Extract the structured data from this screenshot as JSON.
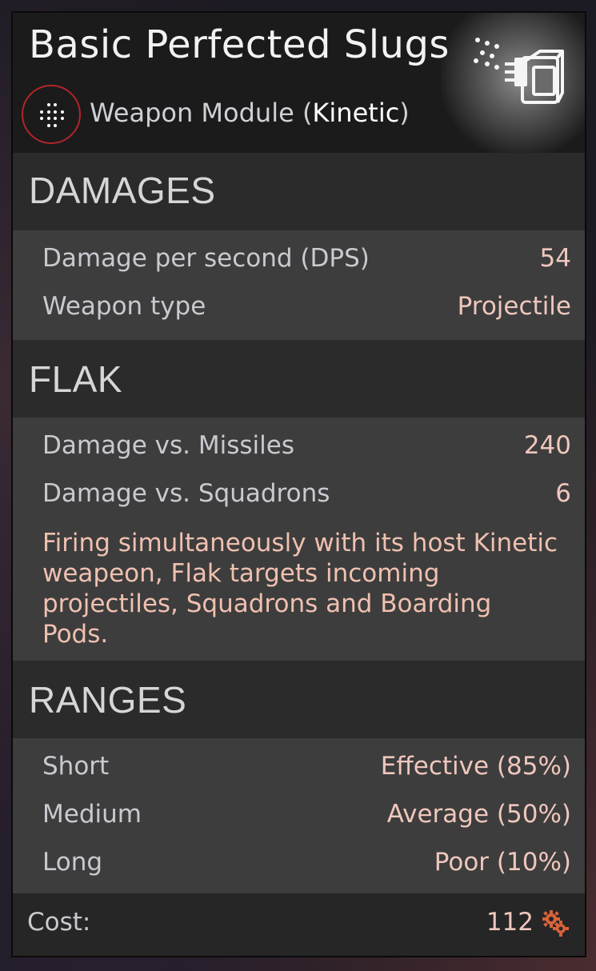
{
  "header": {
    "title": "Basic Perfected Slugs",
    "subtitle_prefix": "Weapon Module (",
    "subtitle_type": "Kinetic",
    "subtitle_suffix": ")",
    "type_icon": "kinetic-dots-icon",
    "module_icon": "flak-turret-module-icon",
    "accent_color": "#b3242b"
  },
  "sections": {
    "damages": {
      "title": "DAMAGES",
      "rows": [
        {
          "label": "Damage per second (DPS)",
          "value": "54"
        },
        {
          "label": "Weapon type",
          "value": "Projectile"
        }
      ]
    },
    "flak": {
      "title": "FLAK",
      "rows": [
        {
          "label": "Damage vs. Missiles",
          "value": "240"
        },
        {
          "label": "Damage vs. Squadrons",
          "value": "6"
        }
      ],
      "description": "Firing simultaneously with its host Kinetic weapeon, Flak targets incoming projectiles, Squadrons and Boarding Pods."
    },
    "ranges": {
      "title": "RANGES",
      "rows": [
        {
          "label": "Short",
          "value": "Effective (85%)"
        },
        {
          "label": "Medium",
          "value": "Average (50%)"
        },
        {
          "label": "Long",
          "value": "Poor (10%)"
        }
      ]
    }
  },
  "footer": {
    "cost_label": "Cost:",
    "cost_value": "112",
    "cost_icon": "industry-gear-icon",
    "value_color": "#efc7bd",
    "description_color": "#f0c0b0"
  }
}
